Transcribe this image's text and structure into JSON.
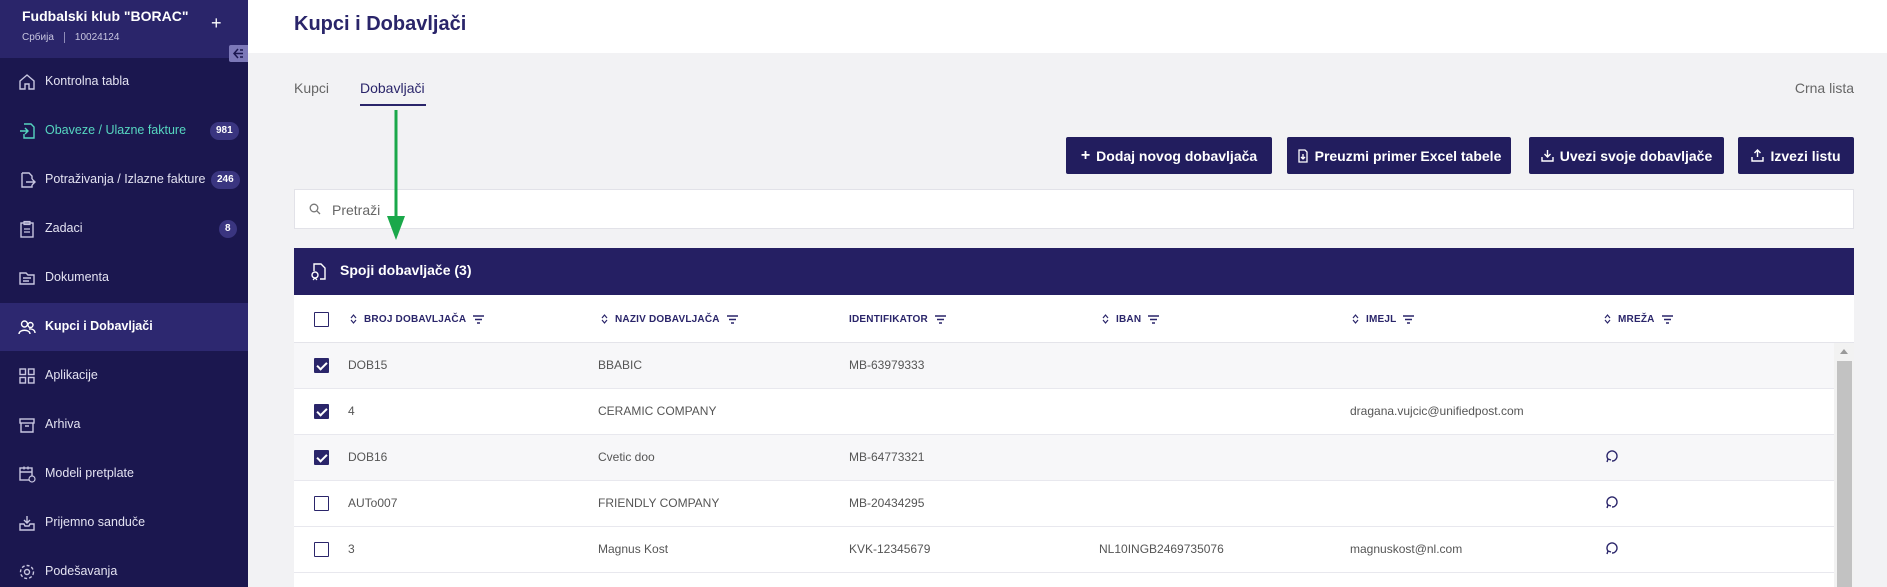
{
  "sidebar": {
    "org_name": "Fudbalski klub \"BORAC\"",
    "org_country": "Србија",
    "org_id": "10024124",
    "items": [
      {
        "label": "Kontrolna tabla",
        "icon": "home-icon"
      },
      {
        "label": "Obaveze / Ulazne fakture",
        "icon": "incoming-invoice-icon",
        "badge": "981"
      },
      {
        "label": "Potraživanja / Izlazne fakture",
        "icon": "outgoing-invoice-icon",
        "badge": "246"
      },
      {
        "label": "Zadaci",
        "icon": "clipboard-icon",
        "badge": "8"
      },
      {
        "label": "Dokumenta",
        "icon": "documents-icon"
      },
      {
        "label": "Kupci i Dobavljači",
        "icon": "contacts-icon"
      },
      {
        "label": "Aplikacije",
        "icon": "apps-icon"
      },
      {
        "label": "Arhiva",
        "icon": "archive-icon"
      },
      {
        "label": "Modeli pretplate",
        "icon": "subscription-icon"
      },
      {
        "label": "Prijemno sanduče",
        "icon": "inbox-icon"
      },
      {
        "label": "Podešavanja",
        "icon": "gear-icon"
      }
    ]
  },
  "header": {
    "title": "Kupci i Dobavljači"
  },
  "tabs": [
    {
      "label": "Kupci"
    },
    {
      "label": "Dobavljači"
    }
  ],
  "blacklist_label": "Crna lista",
  "actions": {
    "add": "Dodaj novog dobavljača",
    "download_template": "Preuzmi primer Excel tabele",
    "import": "Uvezi svoje dobavljače",
    "export": "Izvezi listu"
  },
  "search": {
    "placeholder": "Pretraži"
  },
  "merge": {
    "label": "Spoji dobavljače (3)"
  },
  "table": {
    "columns": [
      "BROJ DOBAVLJAČA",
      "NAZIV DOBAVLJAČA",
      "IDENTIFIKATOR",
      "IBAN",
      "IMEJL",
      "MREŽA"
    ],
    "rows": [
      {
        "checked": true,
        "number": "DOB15",
        "name": "BBABIC",
        "identifier": "MB-63979333",
        "iban": "",
        "email": "",
        "network": false
      },
      {
        "checked": true,
        "number": "4",
        "name": "CERAMIC COMPANY",
        "identifier": "",
        "iban": "",
        "email": "dragana.vujcic@unifiedpost.com",
        "network": false
      },
      {
        "checked": true,
        "number": "DOB16",
        "name": "Cvetic doo",
        "identifier": "MB-64773321",
        "iban": "",
        "email": "",
        "network": true
      },
      {
        "checked": false,
        "number": "AUTo007",
        "name": "FRIENDLY COMPANY",
        "identifier": "MB-20434295",
        "iban": "",
        "email": "",
        "network": true
      },
      {
        "checked": false,
        "number": "3",
        "name": "Magnus Kost",
        "identifier": "KVK-12345679",
        "iban": "NL10INGB2469735076",
        "email": "magnuskost@nl.com",
        "network": true
      }
    ]
  },
  "colors": {
    "primary": "#221d5e",
    "sidebar": "#1b174f",
    "accent": "#56d6c0",
    "annotation": "#1aa84a"
  }
}
